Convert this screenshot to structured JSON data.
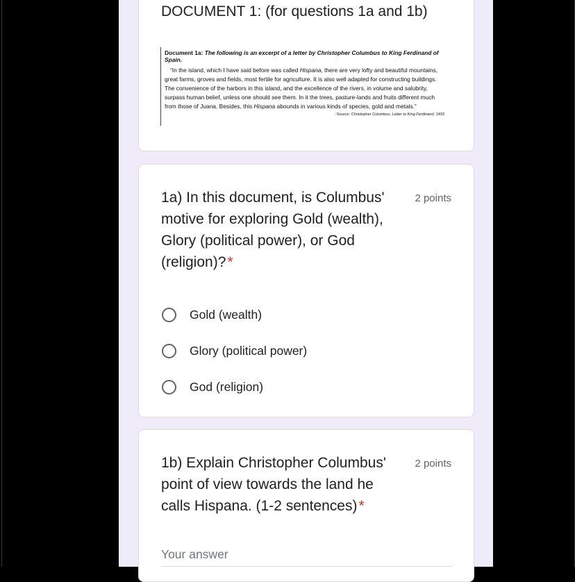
{
  "document_section": {
    "title": "DOCUMENT 1: (for questions 1a and 1b)",
    "image": {
      "label": "Document 1a:",
      "description": "The following is an excerpt of a letter by Christopher Columbus to King Ferdinand of Spain.",
      "quote_part1": "“In the island, which I have said before was called ",
      "quote_hispana": "Hispana",
      "quote_part2": ", there are very lofty and beautiful mountains, great farms, groves and fields, most fertile for agriculture. It is also well adapted for constructing buildings. The convenience of the harbors in this island, and the excellence of the rivers, in volume and salubrity, surpass human belief, unless one should see them. In it the trees, pasture-lands and fruits different much from those of Juana. Besides, this ",
      "quote_hispana2": "Hispana",
      "quote_part3": " abounds in various kinds of species, gold and metals.”",
      "source_prefix": "-Source: Christopher Columbus, ",
      "source_title": "Letter to King Ferdinand",
      "source_year": ", 1493"
    }
  },
  "question_1a": {
    "title": "1a) In this document, is Columbus' motive for exploring Gold (wealth), Glory (political power), or God (religion)?",
    "required_mark": "*",
    "points": "2 points",
    "options": [
      {
        "label": "Gold (wealth)"
      },
      {
        "label": "Glory (political power)"
      },
      {
        "label": "God (religion)"
      }
    ]
  },
  "question_1b": {
    "title": "1b) Explain Christopher Columbus' point of view towards the land he calls Hispana. (1-2 sentences)",
    "required_mark": "*",
    "points": "2 points",
    "answer_placeholder": "Your answer"
  }
}
